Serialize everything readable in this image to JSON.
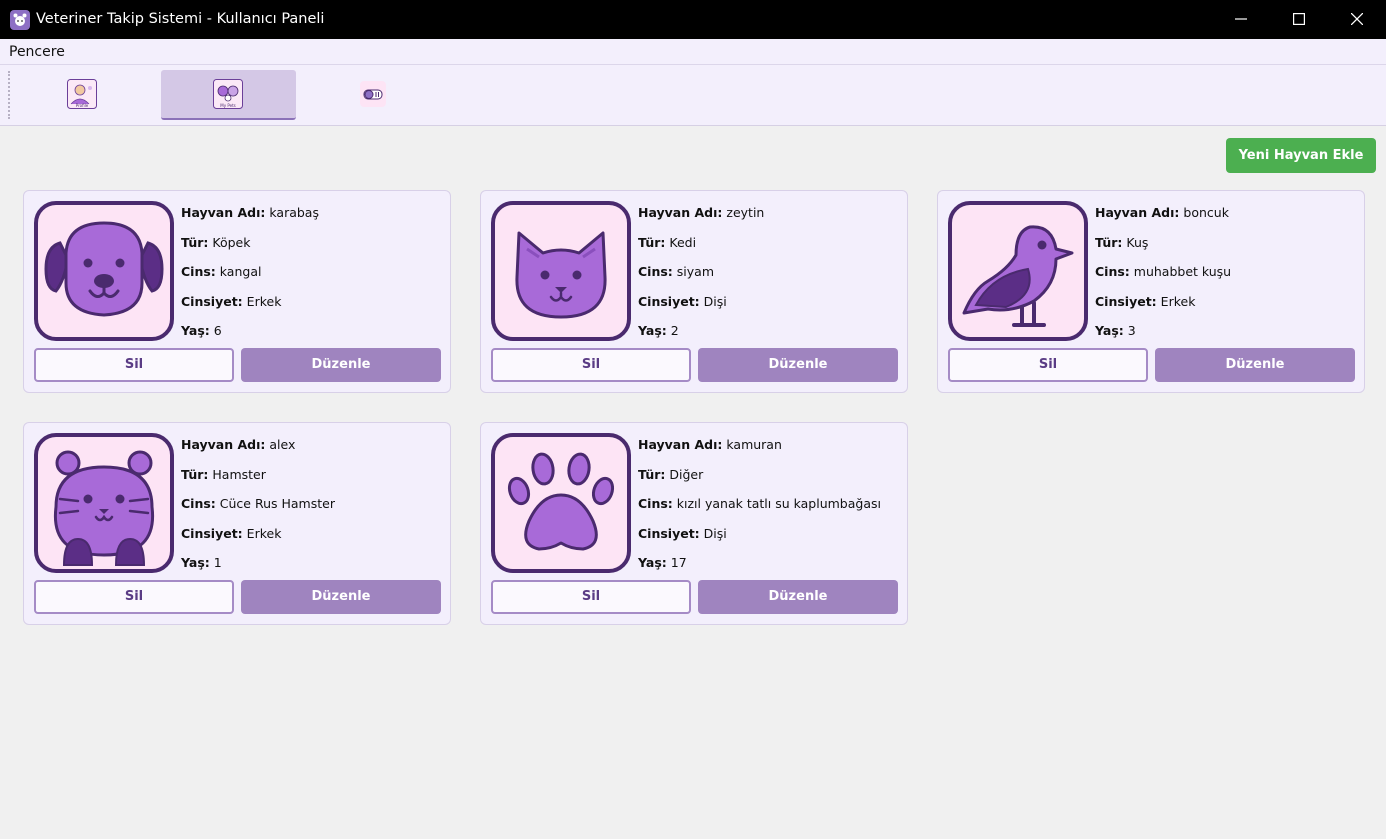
{
  "window": {
    "title": "Veteriner Takip Sistemi - Kullanıcı Paneli",
    "icon": "paw-app-icon",
    "controls": [
      "minimize-icon",
      "maximize-icon",
      "close-icon"
    ]
  },
  "menu": {
    "items": [
      {
        "label": "Pencere"
      }
    ]
  },
  "toolbar": {
    "buttons": [
      {
        "icon": "profile-icon",
        "icon_text": "Profile",
        "active": false
      },
      {
        "icon": "my-pets-icon",
        "icon_text": "My Pets",
        "active": true
      },
      {
        "icon": "appointments-icon",
        "active": false
      }
    ]
  },
  "actions": {
    "add_pet": "Yeni Hayvan Ekle"
  },
  "labels": {
    "name": "Hayvan Adı:",
    "type": "Tür:",
    "breed": "Cins:",
    "gender": "Cinsiyet:",
    "age": "Yaş:",
    "delete": "Sil",
    "edit": "Düzenle"
  },
  "pets": [
    {
      "name": "karabaş",
      "type": "Köpek",
      "breed": "kangal",
      "gender": "Erkek",
      "age": "6",
      "icon": "dog-icon"
    },
    {
      "name": "zeytin",
      "type": "Kedi",
      "breed": "siyam",
      "gender": "Dişi",
      "age": "2",
      "icon": "cat-icon"
    },
    {
      "name": "boncuk",
      "type": "Kuş",
      "breed": "muhabbet kuşu",
      "gender": "Erkek",
      "age": "3",
      "icon": "bird-icon"
    },
    {
      "name": "alex",
      "type": "Hamster",
      "breed": "Cüce Rus Hamster",
      "gender": "Erkek",
      "age": "1",
      "icon": "hamster-icon"
    },
    {
      "name": "kamuran",
      "type": "Diğer",
      "breed": "kızıl yanak tatlı su kaplumbağası",
      "gender": "Dişi",
      "age": "17",
      "icon": "paw-icon"
    }
  ],
  "colors": {
    "accent": "#9f84bf",
    "add_button": "#4caf50",
    "card_bg": "#f3effc",
    "icon_bg": "#fde4f5",
    "icon_fill": "#a86ad8",
    "icon_outline": "#4a2a6e"
  }
}
